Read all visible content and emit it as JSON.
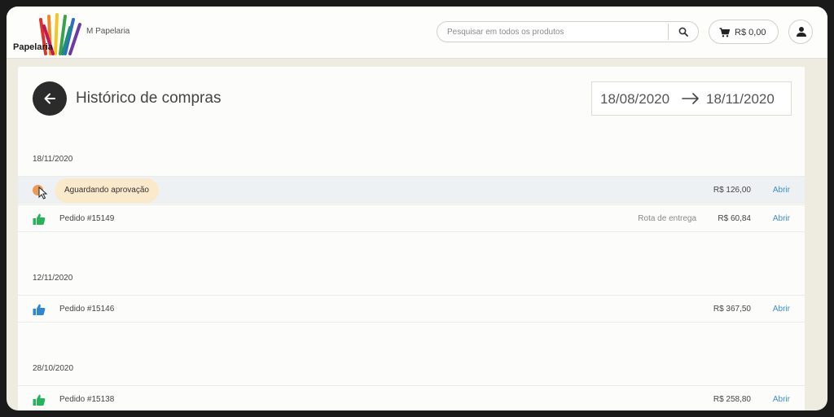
{
  "header": {
    "logo_text": "Papelaria",
    "store_name": "M Papelaria",
    "search_placeholder": "Pesquisar em todos os produtos",
    "cart_total": "R$ 0,00"
  },
  "page": {
    "title": "Histórico de compras",
    "date_from": "18/08/2020",
    "date_to": "18/11/2020"
  },
  "groups": [
    {
      "date": "18/11/2020",
      "rows": [
        {
          "icon": "status-dot",
          "label": "Aguardando aprovação",
          "status": "",
          "value": "R$ 126,00",
          "action": "Abrir",
          "tooltip": true
        },
        {
          "icon": "thumbs-up-green",
          "label": "Pedido #15149",
          "status": "Rota de entrega",
          "value": "R$ 60,84",
          "action": "Abrir"
        }
      ]
    },
    {
      "date": "12/11/2020",
      "rows": [
        {
          "icon": "thumbs-up-blue",
          "label": "Pedido #15146",
          "status": "",
          "value": "R$ 367,50",
          "action": "Abrir"
        }
      ]
    },
    {
      "date": "28/10/2020",
      "rows": [
        {
          "icon": "thumbs-up-green",
          "label": "Pedido #15138",
          "status": "",
          "value": "R$ 258,80",
          "action": "Abrir"
        }
      ]
    }
  ],
  "colors": {
    "thumb_green": "#27b35a",
    "thumb_blue": "#2f86d4",
    "link": "#3b8ed1",
    "pending": "#ec9a55"
  }
}
